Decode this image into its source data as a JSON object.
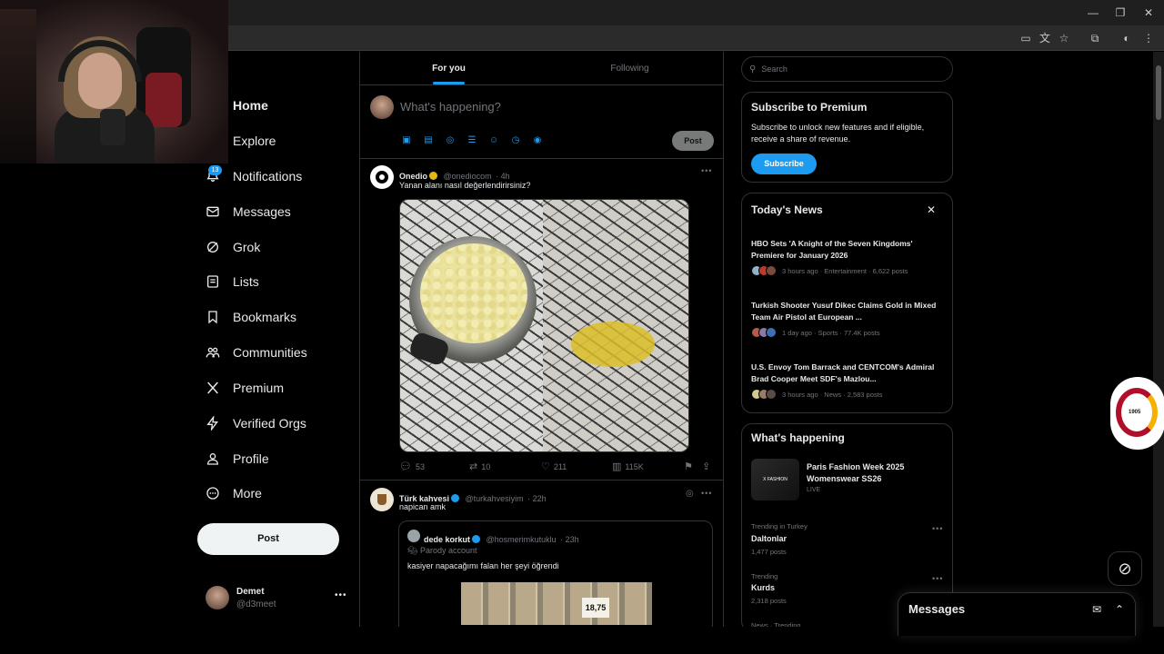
{
  "window": {
    "minimize": "—",
    "restore": "❐",
    "close": "✕"
  },
  "nav": {
    "items": [
      {
        "label": "Home",
        "icon": "home-icon"
      },
      {
        "label": "Explore",
        "icon": "search-icon"
      },
      {
        "label": "Notifications",
        "icon": "bell-icon"
      },
      {
        "label": "Messages",
        "icon": "envelope-icon"
      },
      {
        "label": "Grok",
        "icon": "grok-icon"
      },
      {
        "label": "Lists",
        "icon": "list-icon"
      },
      {
        "label": "Bookmarks",
        "icon": "bookmark-icon"
      },
      {
        "label": "Communities",
        "icon": "people-icon"
      },
      {
        "label": "Premium",
        "icon": "x-logo-icon"
      },
      {
        "label": "Verified Orgs",
        "icon": "lightning-icon"
      },
      {
        "label": "Profile",
        "icon": "person-icon"
      },
      {
        "label": "More",
        "icon": "more-circle-icon"
      }
    ],
    "notification_badge": "13",
    "post_label": "Post"
  },
  "account": {
    "name": "Demet",
    "handle": "@d3meet"
  },
  "tabs": {
    "for_you": "For you",
    "following": "Following"
  },
  "compose": {
    "placeholder": "What's happening?",
    "post_label": "Post"
  },
  "tweet1": {
    "name": "Onedio",
    "handle": "@onediocom",
    "time": "· 4h",
    "text": "Yanan alanı nasıl değerlendirirsiniz?",
    "replies": "53",
    "reposts": "10",
    "likes": "211",
    "views": "115K"
  },
  "tweet2": {
    "name": "Türk kahvesi",
    "handle": "@turkahvesiyim",
    "time": "· 22h",
    "text": "napican amk",
    "quote": {
      "name": "dede korkut",
      "handle": "@hosmerimkutuklu",
      "time": "· 23h",
      "label": "Parody account",
      "text": "kasiyer napacağımı falan her şeyi öğrendi",
      "price": "18,75"
    }
  },
  "search": {
    "placeholder": "Search"
  },
  "premium": {
    "title": "Subscribe to Premium",
    "desc": "Subscribe to unlock new features and if eligible, receive a share of revenue.",
    "button": "Subscribe"
  },
  "news": {
    "title": "Today's News",
    "items": [
      {
        "headline": "HBO Sets 'A Knight of the Seven Kingdoms' Premiere for January 2026",
        "meta": "3 hours ago · Entertainment · 6,622 posts"
      },
      {
        "headline": "Turkish Shooter Yusuf Dikec Claims Gold in Mixed Team Air Pistol at European ...",
        "meta": "1 day ago · Sports · 77.4K posts"
      },
      {
        "headline": "U.S. Envoy Tom Barrack and CENTCOM's Admiral Brad Cooper Meet SDF's Mazlou...",
        "meta": "3 hours ago · News · 2,583 posts"
      }
    ]
  },
  "happening": {
    "title": "What's happening",
    "featured": {
      "title": "Paris Fashion Week 2025 Womenswear SS26",
      "status": "LIVE",
      "thumb_text": "X FASHION"
    },
    "trends": [
      {
        "category": "Trending in Turkey",
        "name": "Daltonlar",
        "count": "1,477 posts"
      },
      {
        "category": "Trending",
        "name": "Kurds",
        "count": "2,318 posts"
      },
      {
        "category": "News · Trending",
        "name": "",
        "count": ""
      }
    ]
  },
  "badge": {
    "year": "1905"
  },
  "messages_drawer": {
    "title": "Messages"
  },
  "colors": {
    "accent": "#1d9bf0",
    "background": "#000000",
    "border": "#2f3336",
    "muted_text": "#71767b"
  }
}
